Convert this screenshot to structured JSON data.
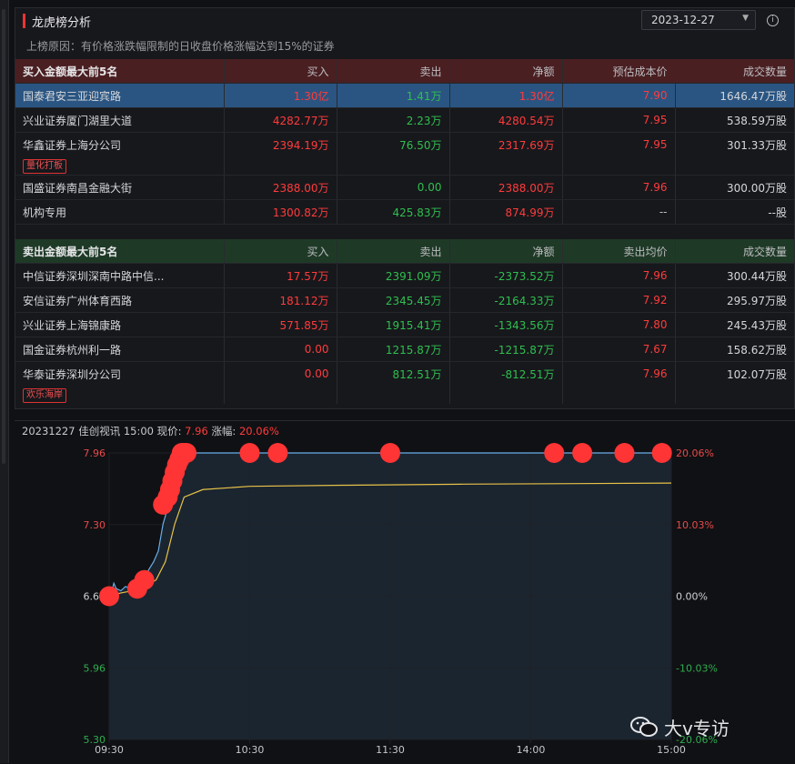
{
  "panel": {
    "title": "龙虎榜分析",
    "date": "2023-12-27",
    "reason": "上榜原因：有价格涨跌幅限制的日收盘价格涨幅达到15%的证券"
  },
  "buy_table": {
    "headers": [
      "买入金额最大前5名",
      "买入",
      "卖出",
      "净额",
      "预估成本价",
      "成交数量"
    ],
    "rows": [
      {
        "name": "国泰君安三亚迎宾路",
        "buy": "1.30亿",
        "sell": "1.41万",
        "net": "1.30亿",
        "price": "7.90",
        "vol": "1646.47万股"
      },
      {
        "name": "兴业证券厦门湖里大道",
        "buy": "4282.77万",
        "sell": "2.23万",
        "net": "4280.54万",
        "price": "7.95",
        "vol": "538.59万股"
      },
      {
        "name": "华鑫证券上海分公司",
        "buy": "2394.19万",
        "sell": "76.50万",
        "net": "2317.69万",
        "price": "7.95",
        "vol": "301.33万股",
        "tag": "量化打板"
      },
      {
        "name": "国盛证券南昌金融大街",
        "buy": "2388.00万",
        "sell": "0.00",
        "net": "2388.00万",
        "price": "7.96",
        "vol": "300.00万股"
      },
      {
        "name": "机构专用",
        "buy": "1300.82万",
        "sell": "425.83万",
        "net": "874.99万",
        "price": "--",
        "vol": "--股"
      }
    ]
  },
  "sell_table": {
    "headers": [
      "卖出金额最大前5名",
      "买入",
      "卖出",
      "净额",
      "卖出均价",
      "成交数量"
    ],
    "rows": [
      {
        "name": "中信证券深圳深南中路中信...",
        "buy": "17.57万",
        "sell": "2391.09万",
        "net": "-2373.52万",
        "price": "7.96",
        "vol": "300.44万股"
      },
      {
        "name": "安信证券广州体育西路",
        "buy": "181.12万",
        "sell": "2345.45万",
        "net": "-2164.33万",
        "price": "7.92",
        "vol": "295.97万股"
      },
      {
        "name": "兴业证券上海锦康路",
        "buy": "571.85万",
        "sell": "1915.41万",
        "net": "-1343.56万",
        "price": "7.80",
        "vol": "245.43万股"
      },
      {
        "name": "国金证券杭州利一路",
        "buy": "0.00",
        "sell": "1215.87万",
        "net": "-1215.87万",
        "price": "7.67",
        "vol": "158.62万股"
      },
      {
        "name": "华泰证券深圳分公司",
        "buy": "0.00",
        "sell": "812.51万",
        "net": "-812.51万",
        "price": "7.96",
        "vol": "102.07万股",
        "tag": "欢乐海岸"
      }
    ]
  },
  "chart_header": {
    "prefix": "20231227 佳创视讯 15:00 现价:",
    "price": "7.96",
    "change_label": "涨幅:",
    "change": "20.06%"
  },
  "chart_data": {
    "type": "line",
    "x_ticks": [
      "09:30",
      "10:30",
      "11:30",
      "14:00",
      "15:00"
    ],
    "y_left_ticks": [
      "7.96",
      "7.30",
      "6.63",
      "5.96",
      "5.30"
    ],
    "y_right_ticks": [
      "20.06%",
      "10.03%",
      "0.00%",
      "-10.03%",
      "-20.06%"
    ],
    "ylim": [
      5.3,
      7.96
    ],
    "prev_close": 6.63,
    "price_series": [
      [
        0,
        6.63
      ],
      [
        1,
        6.66
      ],
      [
        2,
        6.75
      ],
      [
        3,
        6.7
      ],
      [
        5,
        6.68
      ],
      [
        7,
        6.72
      ],
      [
        9,
        6.7
      ],
      [
        11,
        6.74
      ],
      [
        13,
        6.76
      ],
      [
        15,
        6.8
      ],
      [
        17,
        6.88
      ],
      [
        19,
        6.95
      ],
      [
        21,
        7.05
      ],
      [
        23,
        7.3
      ],
      [
        25,
        7.45
      ],
      [
        27,
        7.55
      ],
      [
        29,
        7.7
      ],
      [
        31,
        7.85
      ],
      [
        33,
        7.96
      ],
      [
        240,
        7.96
      ]
    ],
    "avg_series": [
      [
        0,
        6.63
      ],
      [
        5,
        6.66
      ],
      [
        10,
        6.68
      ],
      [
        15,
        6.72
      ],
      [
        20,
        6.78
      ],
      [
        24,
        6.95
      ],
      [
        28,
        7.3
      ],
      [
        32,
        7.55
      ],
      [
        40,
        7.62
      ],
      [
        60,
        7.65
      ],
      [
        100,
        7.66
      ],
      [
        150,
        7.67
      ],
      [
        240,
        7.68
      ]
    ],
    "trade_markers": [
      [
        0,
        6.63
      ],
      [
        12,
        6.7
      ],
      [
        15,
        6.78
      ],
      [
        23,
        7.48
      ],
      [
        25,
        7.55
      ],
      [
        26,
        7.62
      ],
      [
        27,
        7.7
      ],
      [
        28,
        7.78
      ],
      [
        29,
        7.85
      ],
      [
        30,
        7.9
      ],
      [
        31,
        7.96
      ],
      [
        32,
        7.96
      ],
      [
        33,
        7.96
      ],
      [
        60,
        7.96
      ],
      [
        72,
        7.96
      ],
      [
        120,
        7.96
      ],
      [
        190,
        7.96
      ],
      [
        202,
        7.96
      ],
      [
        220,
        7.96
      ],
      [
        236,
        7.96
      ]
    ],
    "colors": {
      "price": "#6aaee6",
      "avg": "#e8c248",
      "marker": "#ff3434",
      "area": "#1b2530"
    }
  },
  "watermark": "大v专访"
}
